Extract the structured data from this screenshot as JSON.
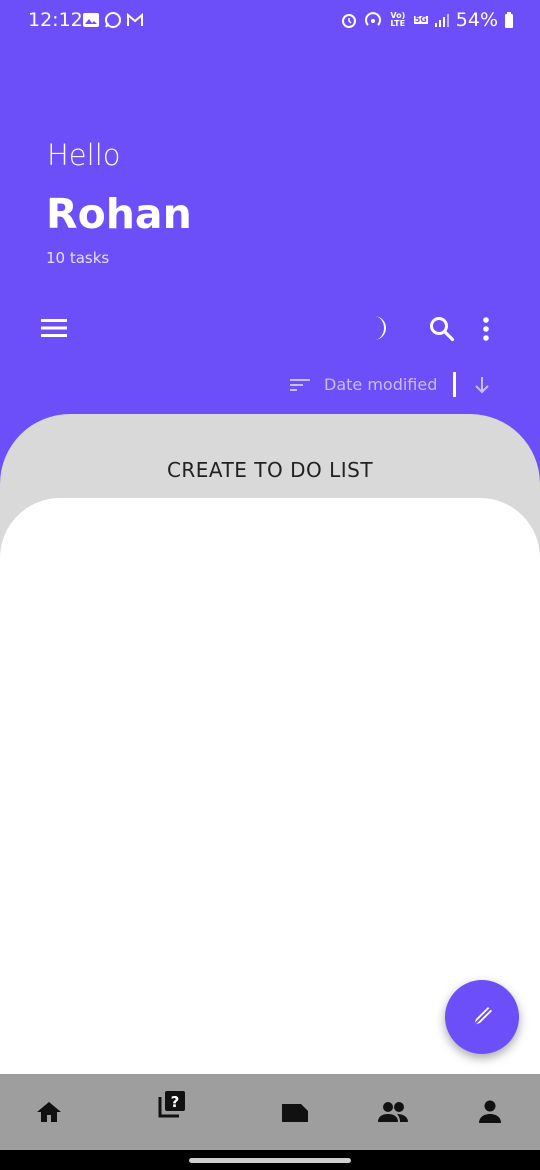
{
  "status_bar": {
    "time": "12:12",
    "battery": "54%",
    "volte_label": "Vo) LTE",
    "network_label": "5G"
  },
  "greeting": {
    "hello": "Hello",
    "name": "Rohan",
    "task_count": "10 tasks"
  },
  "toolbar": {
    "icons": [
      "menu-icon",
      "moon-icon",
      "search-icon",
      "more-vert-icon"
    ]
  },
  "sort": {
    "label": "Date modified",
    "direction": "descending"
  },
  "list": {
    "title": "CREATE TO DO LIST"
  },
  "fab": {
    "icon": "edit-icon"
  },
  "bottom_nav": {
    "items": [
      "home-icon",
      "question-icon",
      "label-icon",
      "group-icon",
      "person-icon"
    ]
  },
  "colors": {
    "primary": "#6c4ff8",
    "sheet": "#d9d9d9",
    "nav": "#9e9e9e"
  }
}
